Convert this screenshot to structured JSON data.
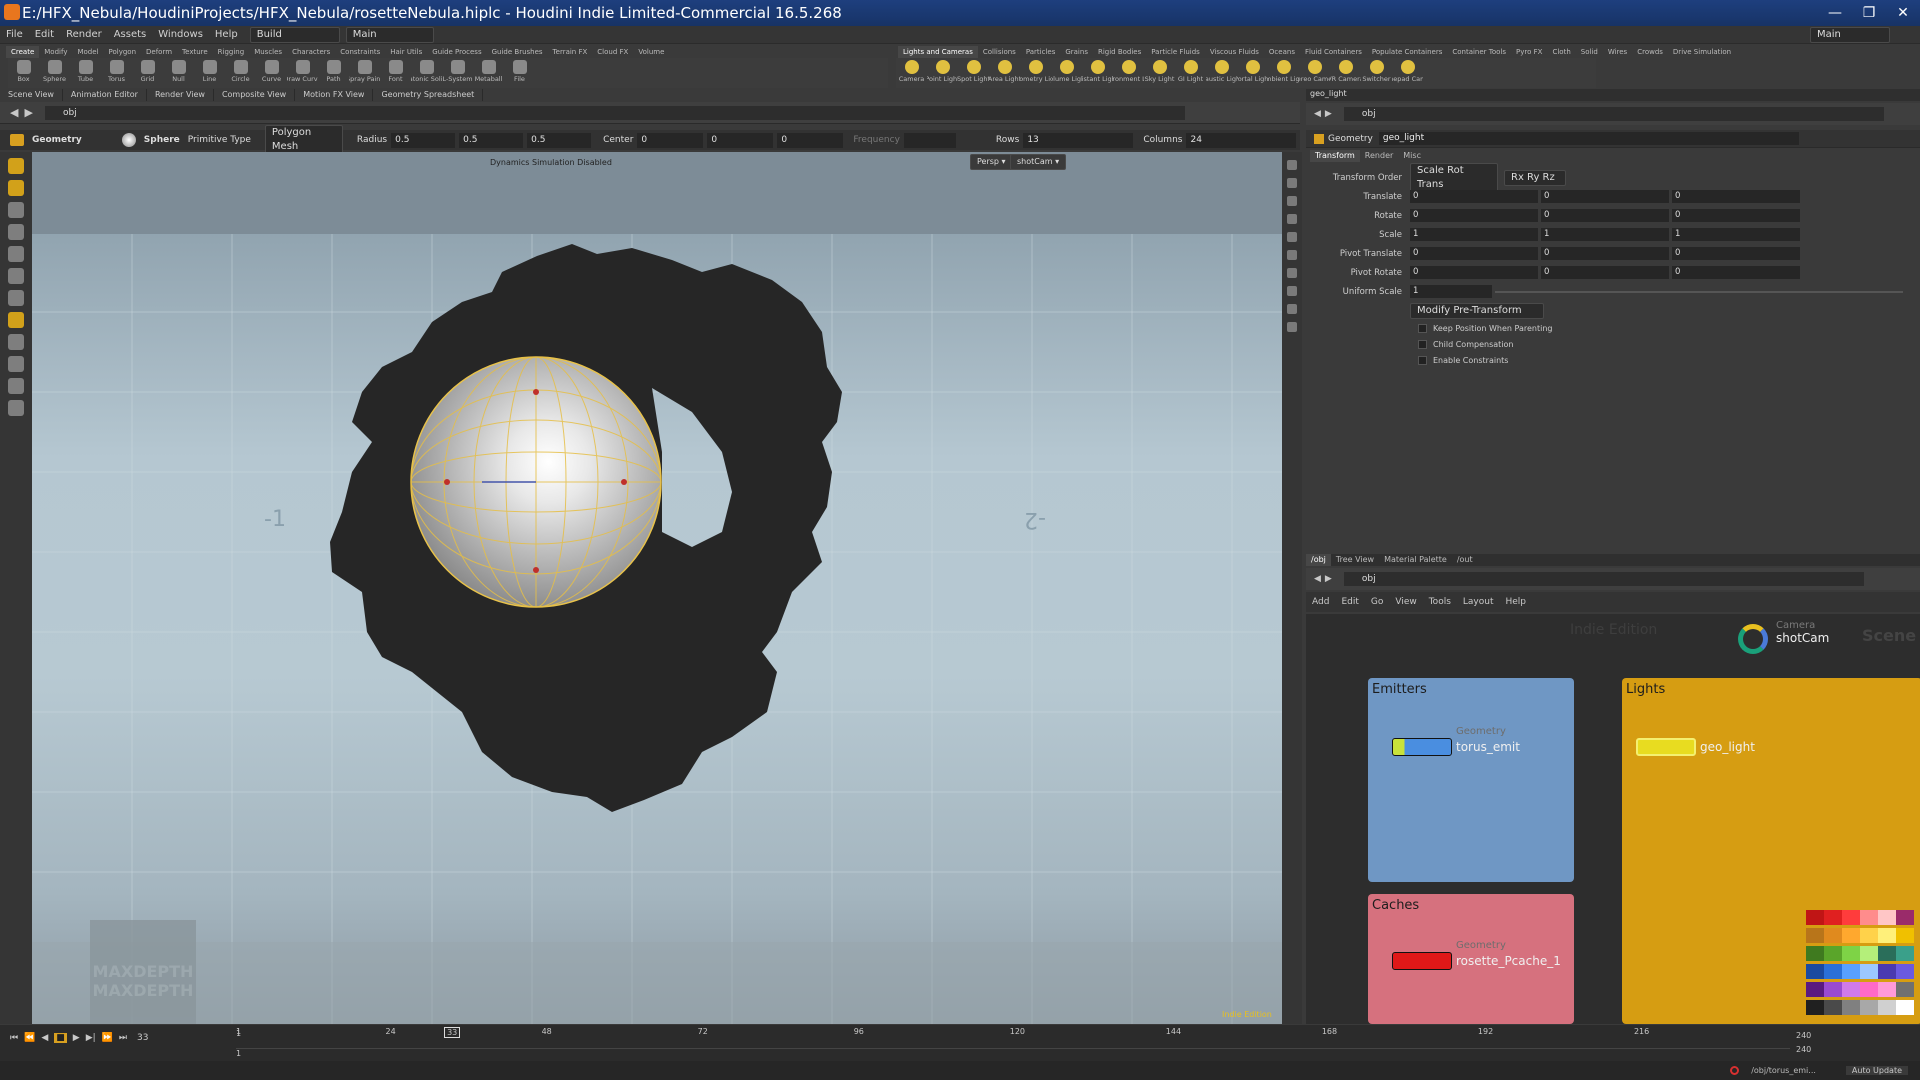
{
  "titlebar": {
    "text": "E:/HFX_Nebula/HoudiniProjects/HFX_Nebula/rosetteNebula.hiplc - Houdini Indie Limited-Commercial 16.5.268",
    "min": "—",
    "max": "❐",
    "close": "✕"
  },
  "menu": {
    "items": [
      "File",
      "Edit",
      "Render",
      "Assets",
      "Windows",
      "Help"
    ],
    "build": "Build",
    "main": "Main",
    "desktop": "Main"
  },
  "shelf_left": {
    "tabs": [
      "Create",
      "Modify",
      "Model",
      "Polygon",
      "Deform",
      "Texture",
      "Rigging",
      "Muscles",
      "Characters",
      "Constraints",
      "Hair Utils",
      "Guide Process",
      "Guide Brushes",
      "Terrain FX",
      "Cloud FX",
      "Volume"
    ],
    "tools": [
      "Box",
      "Sphere",
      "Tube",
      "Torus",
      "Grid",
      "Null",
      "Line",
      "Circle",
      "Curve",
      "Draw Curve",
      "Path",
      "Spray Paint",
      "Font",
      "Platonic Solids",
      "L-System",
      "Metaball",
      "File"
    ]
  },
  "shelf_right": {
    "tabs": [
      "Lights and Cameras",
      "Collisions",
      "Particles",
      "Grains",
      "Rigid Bodies",
      "Particle Fluids",
      "Viscous Fluids",
      "Oceans",
      "Fluid Containers",
      "Populate Containers",
      "Container Tools",
      "Pyro FX",
      "Cloth",
      "Solid",
      "Wires",
      "Crowds",
      "Drive Simulation"
    ],
    "tools": [
      "Camera",
      "Point Light",
      "Spot Light",
      "Area Light",
      "Geometry Light",
      "Volume Light",
      "Distant Light",
      "Environment Light",
      "Sky Light",
      "GI Light",
      "Caustic Light",
      "Portal Light",
      "Ambient Light",
      "Stereo Camera",
      "VR Camera",
      "Switcher",
      "Gamepad Camera"
    ]
  },
  "panetabs": [
    "Scene View",
    "Animation Editor",
    "Render View",
    "Composite View",
    "Motion FX View",
    "Geometry Spreadsheet"
  ],
  "viewport": {
    "path": "obj",
    "geometry": "Geometry",
    "sphere": "Sphere",
    "primtype_label": "Primitive Type",
    "primtype": "Polygon Mesh",
    "radius_label": "Radius",
    "radius": [
      "0.5",
      "0.5",
      "0.5"
    ],
    "center_label": "Center",
    "center": [
      "0",
      "0",
      "0"
    ],
    "frequency_label": "Frequency",
    "rows_label": "Rows",
    "rows": "13",
    "cols_label": "Columns",
    "cols": "24",
    "dyn": "Dynamics Simulation Disabled",
    "persp": "Persp ▾",
    "cam": "shotCam ▾",
    "edition": "Indie Edition",
    "wm1": "MAXDEPTH",
    "wm2": "MAXDEPTH",
    "axis1": "-1",
    "axis2": "-2"
  },
  "params": {
    "tab": "geo_light",
    "path": "obj",
    "type": "Geometry",
    "name": "geo_light",
    "tabs": [
      "Transform",
      "Render",
      "Misc"
    ],
    "xord_label": "Transform Order",
    "xord": "Scale Rot Trans",
    "rord": "Rx Ry Rz",
    "rows": [
      {
        "label": "Translate",
        "v": [
          "0",
          "0",
          "0"
        ]
      },
      {
        "label": "Rotate",
        "v": [
          "0",
          "0",
          "0"
        ]
      },
      {
        "label": "Scale",
        "v": [
          "1",
          "1",
          "1"
        ]
      },
      {
        "label": "Pivot Translate",
        "v": [
          "0",
          "0",
          "0"
        ]
      },
      {
        "label": "Pivot Rotate",
        "v": [
          "0",
          "0",
          "0"
        ]
      }
    ],
    "uscale_label": "Uniform Scale",
    "uscale": "1",
    "modify": "Modify Pre-Transform",
    "checks": [
      "Keep Position When Parenting",
      "Child Compensation",
      "Enable Constraints"
    ]
  },
  "network": {
    "tabs": [
      "/obj",
      "Tree View",
      "Material Palette",
      "/out"
    ],
    "path": "obj",
    "menu": [
      "Add",
      "Edit",
      "Go",
      "View",
      "Tools",
      "Layout",
      "Help"
    ],
    "indie": "Indie Edition",
    "scene": "Scene",
    "camera_type": "Camera",
    "camera_name": "shotCam",
    "emitters": "Emitters",
    "lights": "Lights",
    "caches": "Caches",
    "n1_type": "Geometry",
    "n1_name": "torus_emit",
    "n2_name": "geo_light",
    "n3_type": "Geometry",
    "n3_name": "rosette_Pcache_1",
    "colors": {
      "emitters": "#6f97c4",
      "lights": "#d69d12",
      "caches": "#d6717e"
    }
  },
  "palette": [
    "#c01515",
    "#e02020",
    "#ff3c3c",
    "#ff8c8c",
    "#ffc6c6",
    "#9a2b6a",
    "#b8751a",
    "#e08a1e",
    "#ffa82e",
    "#ffd24a",
    "#fff07a",
    "#f0c000",
    "#3f7a1f",
    "#5aa52a",
    "#7ed346",
    "#b4ef7a",
    "#2a6e5a",
    "#3aa08a",
    "#1a4aa0",
    "#2a70d8",
    "#58a0ff",
    "#9cc8ff",
    "#4a3ab0",
    "#6a5ae0",
    "#5a1a80",
    "#9a4ad0",
    "#d07ae8",
    "#ff6ac8",
    "#ff9ad8",
    "#707070",
    "#202020",
    "#4a4a4a",
    "#808080",
    "#a8a8a8",
    "#d0d0d0",
    "#ffffff"
  ],
  "timeline": {
    "ticks": [
      "1",
      "24",
      "48",
      "72",
      "96",
      "120",
      "144",
      "168",
      "192",
      "216"
    ],
    "current": "33",
    "frame": "33",
    "start": "1",
    "start2": "1",
    "end": "240",
    "end2": "240"
  },
  "status": {
    "path": "/obj/torus_emi...",
    "update": "Auto Update"
  }
}
